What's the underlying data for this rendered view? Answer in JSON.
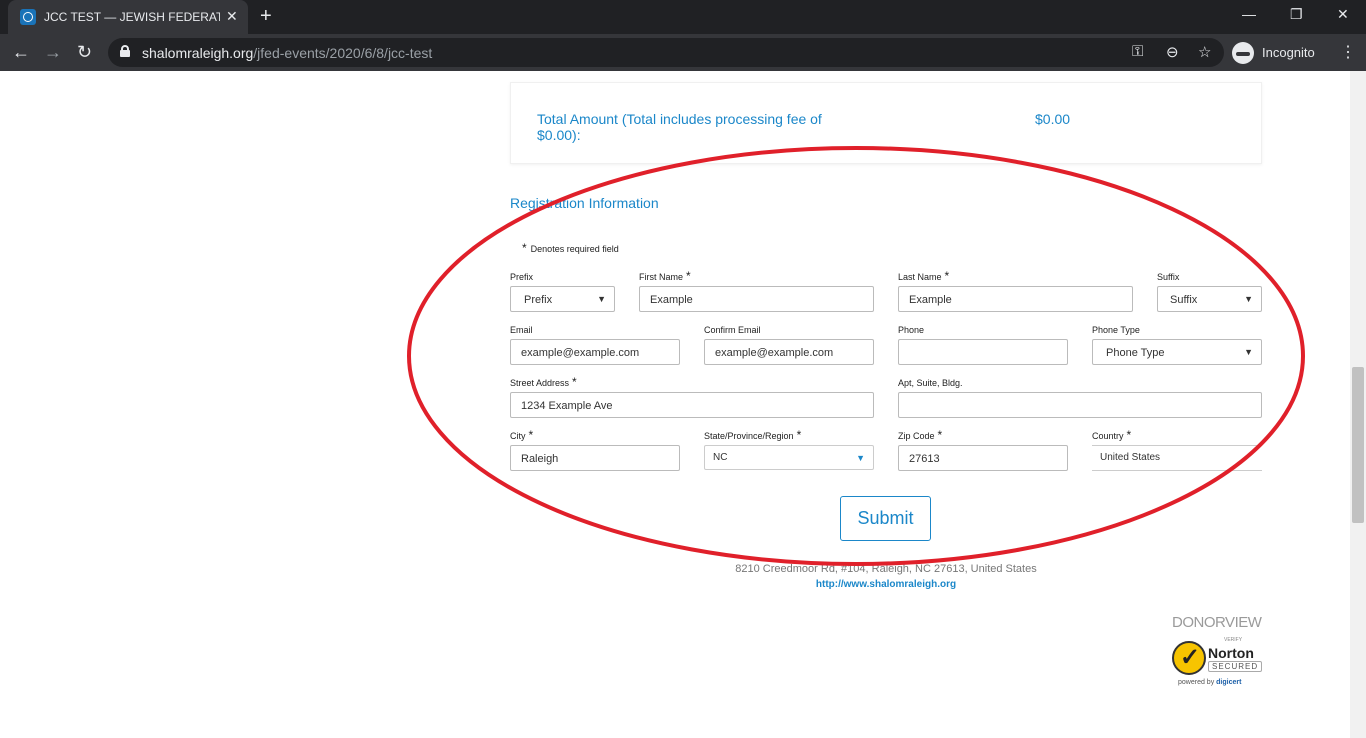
{
  "browser": {
    "tab_title": "JCC TEST — JEWISH FEDERATION",
    "url_host": "shalomraleigh.org",
    "url_path": "/jfed-events/2020/6/8/jcc-test",
    "incognito_label": "Incognito"
  },
  "total": {
    "label": "Total Amount (Total includes processing fee of $0.00):",
    "value": "$0.00"
  },
  "registration": {
    "title": "Registration Information",
    "required_note": "Denotes required field",
    "required_marker": "*",
    "prefix": {
      "label": "Prefix",
      "value": "Prefix"
    },
    "first_name": {
      "label": "First Name",
      "value": "Example"
    },
    "last_name": {
      "label": "Last Name",
      "value": "Example"
    },
    "suffix": {
      "label": "Suffix",
      "value": "Suffix"
    },
    "email": {
      "label": "Email",
      "value": "example@example.com"
    },
    "confirm_email": {
      "label": "Confirm Email",
      "value": "example@example.com"
    },
    "phone": {
      "label": "Phone",
      "value": ""
    },
    "phone_type": {
      "label": "Phone Type",
      "value": "Phone Type"
    },
    "street": {
      "label": "Street Address",
      "value": "1234 Example Ave"
    },
    "apt": {
      "label": "Apt, Suite, Bldg.",
      "value": ""
    },
    "city": {
      "label": "City",
      "value": "Raleigh"
    },
    "state": {
      "label": "State/Province/Region",
      "value": "NC"
    },
    "zip": {
      "label": "Zip Code",
      "value": "27613"
    },
    "country": {
      "label": "Country",
      "value": "United States"
    },
    "submit_label": "Submit"
  },
  "footer": {
    "address": "8210 Creedmoor Rd, #104, Raleigh, NC 27613, United States",
    "link": "http://www.shalomraleigh.org"
  },
  "badges": {
    "donorview": "DONORVIEW",
    "norton_verify": "VERIFY",
    "norton_brand": "Norton",
    "norton_secured": "SECURED",
    "powered_by": "powered by",
    "digicert": "digicert"
  },
  "colors": {
    "accent": "#1b87c9",
    "annotation": "#e0202a"
  }
}
